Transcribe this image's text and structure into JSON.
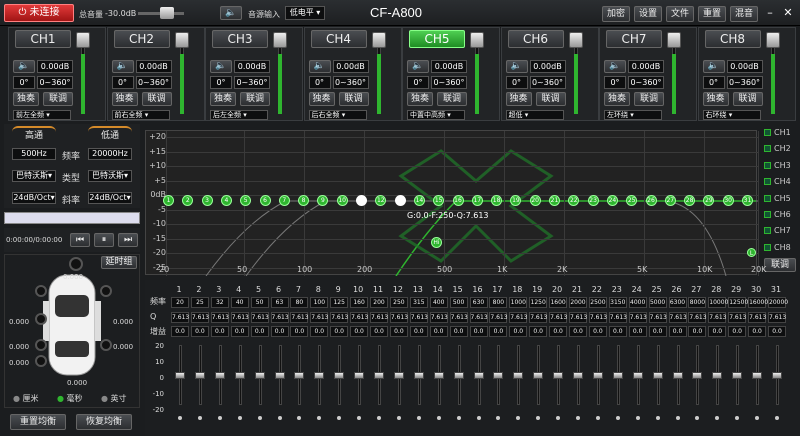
{
  "titlebar": {
    "status_button": "未连接",
    "master_volume_label": "总音量",
    "master_volume_value": "-30.0dB",
    "input_label": "音源输入",
    "input_value": "低电平",
    "app_title": "CF-A800",
    "buttons": [
      "加密",
      "设置",
      "文件",
      "重置",
      "混音"
    ],
    "minimize": "–",
    "close": "✕"
  },
  "channels": [
    {
      "name": "CH1",
      "gain": "0.00dB",
      "phase": "0°",
      "range": "0~360°",
      "solo": "独奏",
      "tune": "联调",
      "position": "前左全频",
      "active": false,
      "level": 0.75
    },
    {
      "name": "CH2",
      "gain": "0.00dB",
      "phase": "0°",
      "range": "0~360°",
      "solo": "独奏",
      "tune": "联调",
      "position": "前右全频",
      "active": false,
      "level": 0.75
    },
    {
      "name": "CH3",
      "gain": "0.00dB",
      "phase": "0°",
      "range": "0~360°",
      "solo": "独奏",
      "tune": "联调",
      "position": "后左全频",
      "active": false,
      "level": 0.75
    },
    {
      "name": "CH4",
      "gain": "0.00dB",
      "phase": "0°",
      "range": "0~360°",
      "solo": "独奏",
      "tune": "联调",
      "position": "后右全频",
      "active": false,
      "level": 0.75
    },
    {
      "name": "CH5",
      "gain": "0.00dB",
      "phase": "0°",
      "range": "0~360°",
      "solo": "独奏",
      "tune": "联调",
      "position": "中置中高频",
      "active": true,
      "level": 0.75
    },
    {
      "name": "CH6",
      "gain": "0.00dB",
      "phase": "0°",
      "range": "0~360°",
      "solo": "独奏",
      "tune": "联调",
      "position": "超低",
      "active": false,
      "level": 0.75
    },
    {
      "name": "CH7",
      "gain": "0.00dB",
      "phase": "0°",
      "range": "0~360°",
      "solo": "独奏",
      "tune": "联调",
      "position": "左环绕",
      "active": false,
      "level": 0.75
    },
    {
      "name": "CH8",
      "gain": "0.00dB",
      "phase": "0°",
      "range": "0~360°",
      "solo": "独奏",
      "tune": "联调",
      "position": "右环绕",
      "active": false,
      "level": 0.75
    }
  ],
  "crossover": {
    "high_pass_label": "高通",
    "low_pass_label": "低通",
    "high_freq": "500Hz",
    "freq_label": "频率",
    "low_freq": "20000Hz",
    "high_type": "巴特沃斯",
    "type_label": "类型",
    "low_type": "巴特沃斯",
    "high_slope": "24dB/Oct",
    "slope_label": "斜率",
    "low_slope": "24dB/Oct"
  },
  "player": {
    "time": "0:00:00/0:00:00",
    "prev": "⏮",
    "pause": "⏸",
    "next": "⏭"
  },
  "delay": {
    "button": "延时组",
    "values": {
      "top": "0.000",
      "left1": "0.000",
      "left2": "0.000",
      "left3": "0.000",
      "right1": "0.000",
      "right2": "0.000",
      "bottom": "0.000"
    },
    "units": [
      "厘米",
      "毫秒",
      "英寸"
    ],
    "selected_unit": "毫秒"
  },
  "bottom_buttons": {
    "reset_eq": "重置均衡",
    "restore_eq": "恢复均衡"
  },
  "graph": {
    "y_labels": [
      "+20",
      "+15",
      "+10",
      "+5",
      "0dB",
      "-5",
      "-10",
      "-15",
      "-20",
      "-25"
    ],
    "x_labels": [
      "20",
      "50",
      "100",
      "200",
      "500",
      "1K",
      "2K",
      "5K",
      "10K",
      "20K"
    ],
    "info": "G:0.0-F:250-Q:7.613",
    "points": [
      "1",
      "2",
      "3",
      "4",
      "5",
      "6",
      "7",
      "8",
      "9",
      "10",
      "11",
      "12",
      "13",
      "14",
      "15",
      "16",
      "17",
      "18",
      "19",
      "20",
      "21",
      "22",
      "23",
      "24",
      "25",
      "26",
      "27",
      "28",
      "29",
      "30",
      "31"
    ],
    "hi_marker": "Hi",
    "lo_marker": "L",
    "link_button": "联调",
    "legend": [
      "CH1",
      "CH2",
      "CH3",
      "CH4",
      "CH5",
      "CH6",
      "CH7",
      "CH8"
    ]
  },
  "eq": {
    "row_labels": {
      "freq": "频率",
      "q": "Q",
      "gain": "增益"
    },
    "bands": [
      "1",
      "2",
      "3",
      "4",
      "5",
      "6",
      "7",
      "8",
      "9",
      "10",
      "11",
      "12",
      "13",
      "14",
      "15",
      "16",
      "17",
      "18",
      "19",
      "20",
      "21",
      "22",
      "23",
      "24",
      "25",
      "26",
      "27",
      "28",
      "29",
      "30",
      "31"
    ],
    "freqs": [
      "20",
      "25",
      "32",
      "40",
      "50",
      "63",
      "80",
      "100",
      "125",
      "160",
      "200",
      "250",
      "315",
      "400",
      "500",
      "630",
      "800",
      "1000",
      "1250",
      "1600",
      "2000",
      "2500",
      "3150",
      "4000",
      "5000",
      "6300",
      "8000",
      "10000",
      "12500",
      "16000",
      "20000"
    ],
    "q": "7.613",
    "gain": "0.0",
    "scale": [
      "20",
      "10",
      "0",
      "-10",
      "-20"
    ]
  },
  "colors": {
    "accent": "#2fb52f",
    "danger": "#d42424"
  }
}
